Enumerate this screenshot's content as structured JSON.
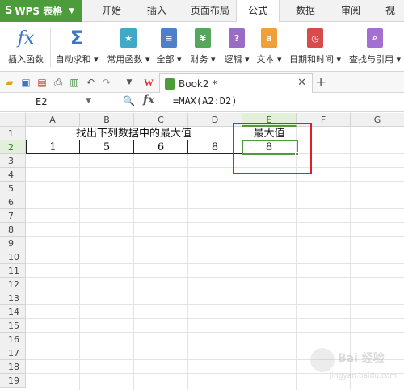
{
  "app": {
    "title": "WPS 表格"
  },
  "menu": {
    "items": [
      "开始",
      "插入",
      "页面布局",
      "公式",
      "数据",
      "审阅",
      "视"
    ],
    "active": "公式"
  },
  "ribbon": {
    "insert_function": "插入函数",
    "autosum": "自动求和",
    "common": "常用函数",
    "all": "全部",
    "finance": "财务",
    "logic": "逻辑",
    "text": "文本",
    "datetime": "日期和时间",
    "lookup": "查找与引用"
  },
  "doc_tab": {
    "name": "Book2 *"
  },
  "formula_bar": {
    "name_box": "E2",
    "formula": "=MAX(A2:D2)"
  },
  "columns": [
    "A",
    "B",
    "C",
    "D",
    "E",
    "F",
    "G"
  ],
  "rows": [
    "1",
    "2",
    "3",
    "4",
    "5",
    "6",
    "7",
    "8",
    "9",
    "10",
    "11",
    "12",
    "13",
    "14",
    "15",
    "16",
    "17",
    "18",
    "19"
  ],
  "cells": {
    "title": "找出下列数据中的最大值",
    "max_header": "最大值",
    "a2": "1",
    "b2": "5",
    "c2": "6",
    "d2": "8",
    "e2": "8"
  },
  "watermark": {
    "line1": "Bai 经验",
    "line2": "jingyan.baidu.com"
  },
  "colors": {
    "wps_green": "#4d9c3c",
    "highlight_red": "#e02020"
  }
}
